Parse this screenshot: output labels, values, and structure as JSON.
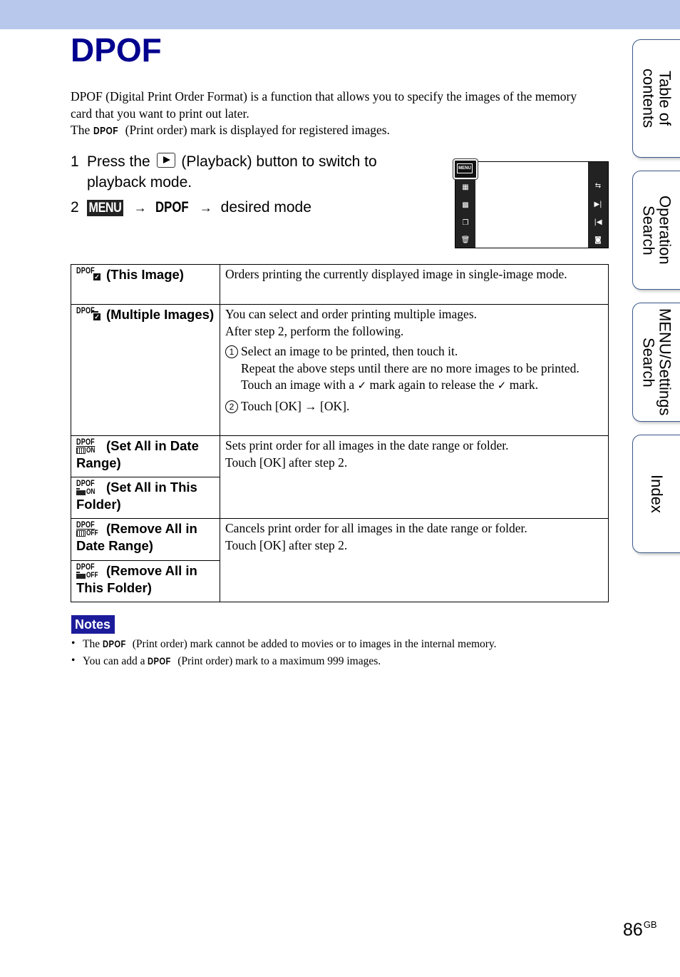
{
  "header": {
    "band_color": "#b8c8ec"
  },
  "title": "DPOF",
  "title_color": "#00008f",
  "intro": {
    "line1": "DPOF (Digital Print Order Format) is a function that allows you to specify the images of the memory card that you want to print out later.",
    "line2_prefix": "The",
    "line2_mark": "DPOF",
    "line2_suffix": "(Print order) mark is displayed for registered images."
  },
  "steps": [
    {
      "num": "1",
      "prefix": "Press the",
      "icon": "playback-button-icon",
      "suffix": "(Playback) button to switch to playback mode."
    },
    {
      "num": "2",
      "menu_label": "MENU",
      "arrow": "→",
      "dpof_label": "DPOF",
      "arrow2": "→",
      "suffix": "desired mode"
    }
  ],
  "camera_screen": {
    "menu_label": "MENU",
    "left_icons": [
      "index-view-icon",
      "calendar-view-icon",
      "slideshow-icon",
      "delete-icon"
    ],
    "right_icons": [
      "resize-icon",
      "next-icon",
      "previous-icon",
      "shooting-mode-icon"
    ]
  },
  "table": {
    "rows": [
      {
        "icon": "dpof-this-image-icon",
        "icon_label": "DPOF",
        "name": "(This Image)",
        "desc": "Orders printing the currently displayed image in single-image mode."
      },
      {
        "icon": "dpof-multiple-images-icon",
        "icon_label": "DPOF",
        "name": "(Multiple Images)",
        "desc_line1": "You can select and order printing multiple images.",
        "desc_line2": "After step 2, perform the following.",
        "sub1_num": "1",
        "sub1_a": "Select an image to be printed, then touch it.",
        "sub1_b_prefix": "Repeat the above steps until there are no more images to be printed. Touch an image with a",
        "sub1_b_mid": "mark again to release the",
        "sub1_b_suffix": "mark.",
        "sub2_num": "2",
        "sub2": "Touch [OK] → [OK]."
      },
      {
        "icon": "dpof-set-all-date-icon",
        "icon_label": "DPOF",
        "icon_state": "ON",
        "name": "(Set All in Date Range)",
        "desc_line1": "Sets print order for all images in the date range or folder.",
        "desc_line2": "Touch [OK] after step 2."
      },
      {
        "icon": "dpof-set-all-folder-icon",
        "icon_label": "DPOF",
        "icon_state": "ON",
        "name": "(Set All in This Folder)"
      },
      {
        "icon": "dpof-remove-all-date-icon",
        "icon_label": "DPOF",
        "icon_state": "OFF",
        "name": "(Remove All in Date Range)",
        "desc_line1": "Cancels print order for all images in the date range or folder.",
        "desc_line2": "Touch [OK] after step 2."
      },
      {
        "icon": "dpof-remove-all-folder-icon",
        "icon_label": "DPOF",
        "icon_state": "OFF",
        "name": "(Remove All in This Folder)"
      }
    ]
  },
  "notes": {
    "label": "Notes",
    "badge_color": "#1c1c9a",
    "items": [
      {
        "prefix": "The",
        "mark": "DPOF",
        "suffix": "(Print order) mark cannot be added to movies or to images in the internal memory."
      },
      {
        "prefix": "You can add a",
        "mark": "DPOF",
        "suffix": "(Print order) mark to a maximum 999 images."
      }
    ]
  },
  "side_tabs": [
    {
      "label": "Table of\ncontents"
    },
    {
      "label": "Operation\nSearch"
    },
    {
      "label": "MENU/Settings\nSearch"
    },
    {
      "label": "Index"
    }
  ],
  "page": {
    "number": "86",
    "suffix": "GB"
  }
}
